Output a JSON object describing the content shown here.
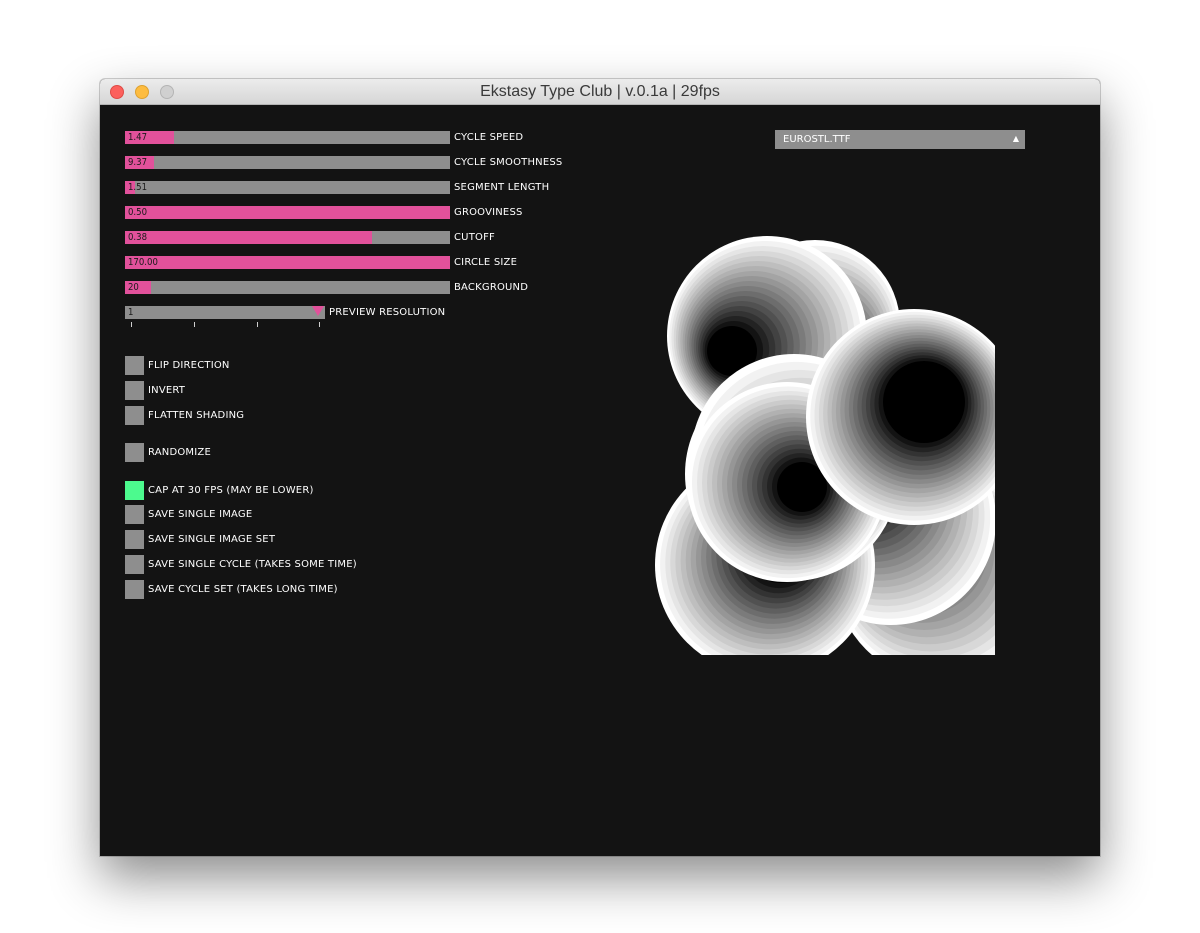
{
  "window": {
    "title": "Ekstasy Type Club | v.0.1a | 29fps"
  },
  "sliders": [
    {
      "value": "1.47",
      "label": "CYCLE SPEED",
      "fill": 0.15
    },
    {
      "value": "9.37",
      "label": "CYCLE SMOOTHNESS",
      "fill": 0.09
    },
    {
      "value": "1.51",
      "label": "SEGMENT LENGTH",
      "fill": 0.03
    },
    {
      "value": "0.50",
      "label": "GROOVINESS",
      "fill": 1.0
    },
    {
      "value": "0.38",
      "label": "CUTOFF",
      "fill": 0.76
    },
    {
      "value": "170.00",
      "label": "CIRCLE SIZE",
      "fill": 1.0
    },
    {
      "value": "20",
      "label": "BACKGROUND",
      "fill": 0.08
    }
  ],
  "preview_resolution": {
    "value": "1",
    "label": "PREVIEW RESOLUTION",
    "position": 1.0
  },
  "toggles_a": [
    {
      "label": "FLIP DIRECTION",
      "on": false
    },
    {
      "label": "INVERT",
      "on": false
    },
    {
      "label": "FLATTEN SHADING",
      "on": false
    }
  ],
  "randomize": {
    "label": "RANDOMIZE"
  },
  "actions": [
    {
      "label": "CAP AT 30 FPS (MAY BE LOWER)",
      "on": true
    },
    {
      "label": "SAVE SINGLE IMAGE",
      "on": false
    },
    {
      "label": "SAVE SINGLE IMAGE SET",
      "on": false
    },
    {
      "label": "SAVE SINGLE CYCLE (TAKES SOME TIME)",
      "on": false
    },
    {
      "label": "SAVE CYCLE SET (TAKES LONG TIME)",
      "on": false
    }
  ],
  "font_select": {
    "value": "EUROSTL.TTF",
    "arrow_icon": "triangle-up-icon"
  },
  "colors": {
    "accent": "#e2519b",
    "active_toggle": "#4cfa8e",
    "control_gray": "#8e8e8e",
    "background": "#131313"
  }
}
